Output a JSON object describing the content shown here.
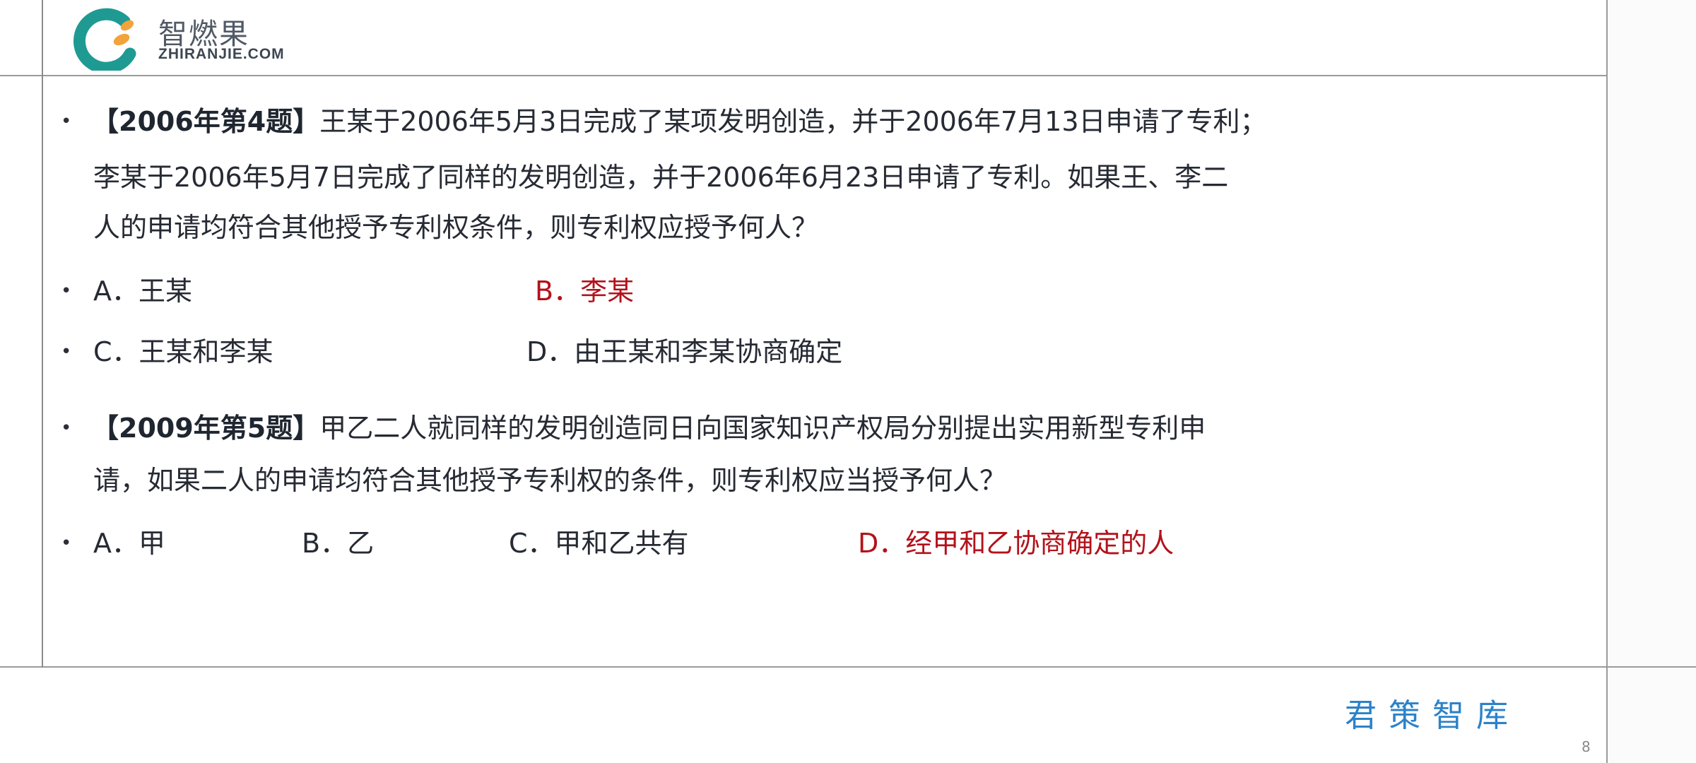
{
  "logo": {
    "name_cn": "智燃果",
    "name_en": "ZHIRANJIE.COM",
    "colors": {
      "teal": "#1f9a93",
      "orange": "#f2a33a"
    }
  },
  "questions": [
    {
      "tag": "【2006年第4题】",
      "lines": [
        "王某于2006年5月3日完成了某项发明创造，并于2006年7月13日申请了专利；",
        "李某于2006年5月7日完成了同样的发明创造，并于2006年6月23日申请了专利。如果王、李二",
        "人的申请均符合其他授予专利权条件，则专利权应授予何人？"
      ],
      "options": [
        {
          "label": "A．王某",
          "correct": false
        },
        {
          "label": "B．李某",
          "correct": true
        },
        {
          "label": "C．王某和李某",
          "correct": false
        },
        {
          "label": "D．由王某和李某协商确定",
          "correct": false
        }
      ]
    },
    {
      "tag": "【2009年第5题】",
      "lines": [
        "甲乙二人就同样的发明创造同日向国家知识产权局分别提出实用新型专利申",
        "请，如果二人的申请均符合其他授予专利权的条件，则专利权应当授予何人？"
      ],
      "options": [
        {
          "label": "A．甲",
          "correct": false
        },
        {
          "label": "B．乙",
          "correct": false
        },
        {
          "label": "C．甲和乙共有",
          "correct": false
        },
        {
          "label": "D．经甲和乙协商确定的人",
          "correct": true
        }
      ]
    }
  ],
  "footer": {
    "brand": "君策智库",
    "page_number": "8"
  },
  "colors": {
    "correct_answer": "#b3121b",
    "brand_blue": "#2c82c9",
    "frame_line": "#9a9a9a"
  }
}
